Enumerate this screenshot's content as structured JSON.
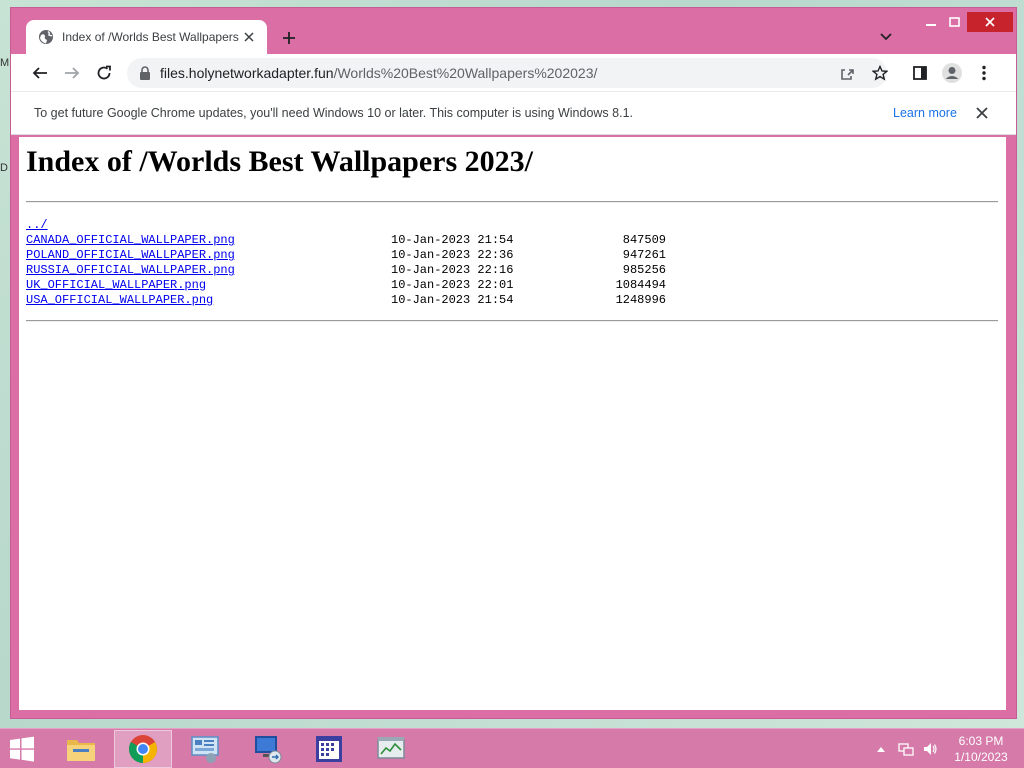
{
  "desktop": {
    "sliver_top": "M",
    "sliver_mid": "D"
  },
  "browser": {
    "tab": {
      "title": "Index of /Worlds Best Wallpapers 2023/"
    },
    "address": {
      "host": "files.holynetworkadapter.fun",
      "path": "/Worlds%20Best%20Wallpapers%202023/"
    },
    "infobar": {
      "message": "To get future Google Chrome updates, you'll need Windows 10 or later. This computer is using Windows 8.1.",
      "link": "Learn more"
    },
    "colors": {
      "frame": "#db6fa5",
      "close_button": "#c7232d",
      "link": "#1a73e8"
    }
  },
  "page": {
    "heading": "Index of /Worlds Best Wallpapers 2023/",
    "parent_link": "../",
    "files": [
      {
        "name": "CANADA_OFFICIAL_WALLPAPER.png",
        "date": "10-Jan-2023 21:54",
        "size": "847509"
      },
      {
        "name": "POLAND_OFFICIAL_WALLPAPER.png",
        "date": "10-Jan-2023 22:36",
        "size": "947261"
      },
      {
        "name": "RUSSIA_OFFICIAL_WALLPAPER.png",
        "date": "10-Jan-2023 22:16",
        "size": "985256"
      },
      {
        "name": "UK_OFFICIAL_WALLPAPER.png",
        "date": "10-Jan-2023 22:01",
        "size": "1084494"
      },
      {
        "name": "USA_OFFICIAL_WALLPAPER.png",
        "date": "10-Jan-2023 21:54",
        "size": "1248996"
      }
    ]
  },
  "taskbar": {
    "apps": [
      "file-explorer-icon",
      "chrome-icon",
      "control-panel-icon",
      "remote-desktop-icon",
      "calendar-app-icon",
      "task-manager-icon"
    ],
    "clock": {
      "time": "6:03 PM",
      "date": "1/10/2023"
    }
  }
}
